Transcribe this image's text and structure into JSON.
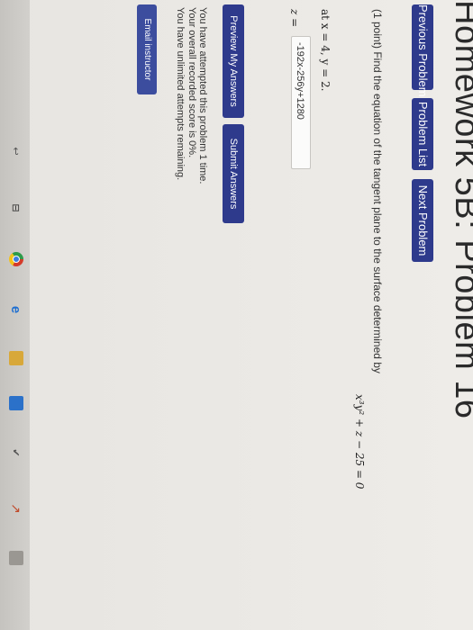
{
  "page": {
    "title": "Homework 5B: Problem 16"
  },
  "nav": {
    "previous_label": "Previous Problem",
    "list_label": "Problem List",
    "next_label": "Next Problem"
  },
  "problem": {
    "prompt": "(1 point) Find the equation of the tangent plane to the surface determined by",
    "equation": "x³y² + z − 25 = 0",
    "at_text": "at x = 4, y = 2.",
    "z_label": "z =",
    "answer_value": "-192x-256y+1280"
  },
  "actions": {
    "preview_label": "Preview My Answers",
    "submit_label": "Submit Answers"
  },
  "status": {
    "attempts": "You have attempted this problem 1 time.",
    "score": "Your overall recorded score is 0%.",
    "remaining": "You have unlimited attempts remaining."
  },
  "email": {
    "label": "Email instructor"
  },
  "taskbar": {
    "back_glyph": "↩",
    "view_glyph": "⊟",
    "edge_glyph": "e",
    "app1_glyph": "✔",
    "app2_glyph": "↗",
    "corner_glyph": "ʌ",
    "icons": [
      "back-arrow-icon",
      "task-view-icon",
      "chrome-icon",
      "edge-icon",
      "file-explorer-icon",
      "store-icon",
      "app-icon",
      "app-icon",
      "app-icon"
    ]
  }
}
